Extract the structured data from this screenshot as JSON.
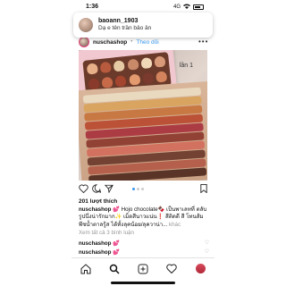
{
  "status": {
    "time": "1:36",
    "signal": "4G"
  },
  "notification": {
    "user": "baoann_1903",
    "message": "Dạ e tên trần bảo ân"
  },
  "post": {
    "username": "nuschashop",
    "separator": "•",
    "follow_label": "Theo dõi",
    "photo_label": "lần 1",
    "likes": "201 lượt thích",
    "caption_user": "nuschashop",
    "caption_text": "💕 Hojo chocolate🍫 เป็นพาเลทที่ ตลับรูปนึ่งน่ารักมาก✨ เม็ดสีนาวแน่น❗ สีติดดี สี โทนส้มพีชน้ำตาลรู้ส ได้ทั้งลุคน้อย/ลุควาน่า...",
    "caption_more": "khác",
    "view_comments": "Xem tất cả 3 bình luận",
    "comments": [
      {
        "user": "nuschashop",
        "text": "💕"
      },
      {
        "user": "nuschashop",
        "text": "💕"
      }
    ]
  },
  "colors": {
    "link": "#3897f0",
    "palette_pink": "#f1c8cf",
    "swatches": [
      "#e9dcc2",
      "#d9a35a",
      "#c7743c",
      "#b9492f",
      "#a8323e",
      "#8c3a2e",
      "#6d3a2b",
      "#4f2a20",
      "#d36c5b",
      "#b35a47",
      "#7d4a34"
    ]
  },
  "icons": {
    "post_actions": [
      "heart-icon",
      "comment-icon",
      "share-icon",
      "bookmark-icon"
    ],
    "tabs": [
      "home-icon",
      "search-icon",
      "add-icon",
      "activity-icon",
      "profile-icon"
    ]
  }
}
